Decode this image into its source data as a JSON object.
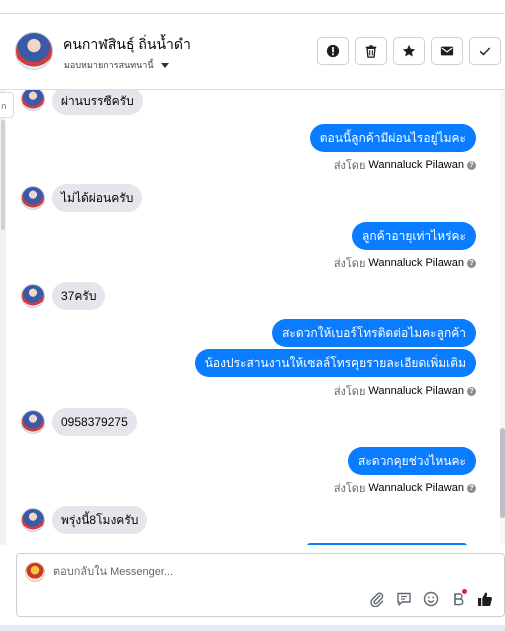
{
  "header": {
    "contact_name": "คนกาฬสินธุ์ ถิ่นน้ำดำ",
    "assign_label": "มอบหมายการสนทนานี้",
    "actions": [
      "report-icon",
      "trash-icon",
      "star-icon",
      "mail-icon",
      "check-icon"
    ]
  },
  "tooltip_stub": "ก",
  "messages": [
    {
      "dir": "in",
      "text": "ผ่านบรรซีครับ"
    },
    {
      "dir": "out",
      "text": "ตอนนี้ลูกค้ามีผ่อนไรอยู่ไมคะ"
    },
    {
      "dir": "in",
      "text": "ไม่ได้ผ่อนครับ"
    },
    {
      "dir": "out",
      "text": "ลูกค้าอายุเท่าไหร่คะ"
    },
    {
      "dir": "in",
      "text": "37ครับ"
    },
    {
      "dir": "out",
      "text": "สะดวกให้เบอร์โทรติดต่อไมคะลูกค้า"
    },
    {
      "dir": "out",
      "text": "น้องประสานงานให้เซลล์โทรคุยรายละเอียดเพิ่มเติม"
    },
    {
      "dir": "in",
      "text": "0958379275"
    },
    {
      "dir": "out",
      "text": "สะดวกคุยช่วงไหนคะ"
    },
    {
      "dir": "in",
      "text": "พรุ่งนี้8โมงครับ"
    }
  ],
  "sent_by": {
    "prefix": "ส่งโดย",
    "name": "Wannaluck Pilawan",
    "info": "?"
  },
  "composer": {
    "placeholder": "ตอบกลับใน Messenger...",
    "tools": [
      "paperclip-icon",
      "saved-reply-icon",
      "emoji-icon",
      "bot-icon",
      "like-icon"
    ]
  },
  "colors": {
    "outgoing_bubble": "#0a7cff",
    "incoming_bubble": "#e4e6eb",
    "like_icon": "#1c1e21",
    "notification_dot": "#e41e3f"
  }
}
